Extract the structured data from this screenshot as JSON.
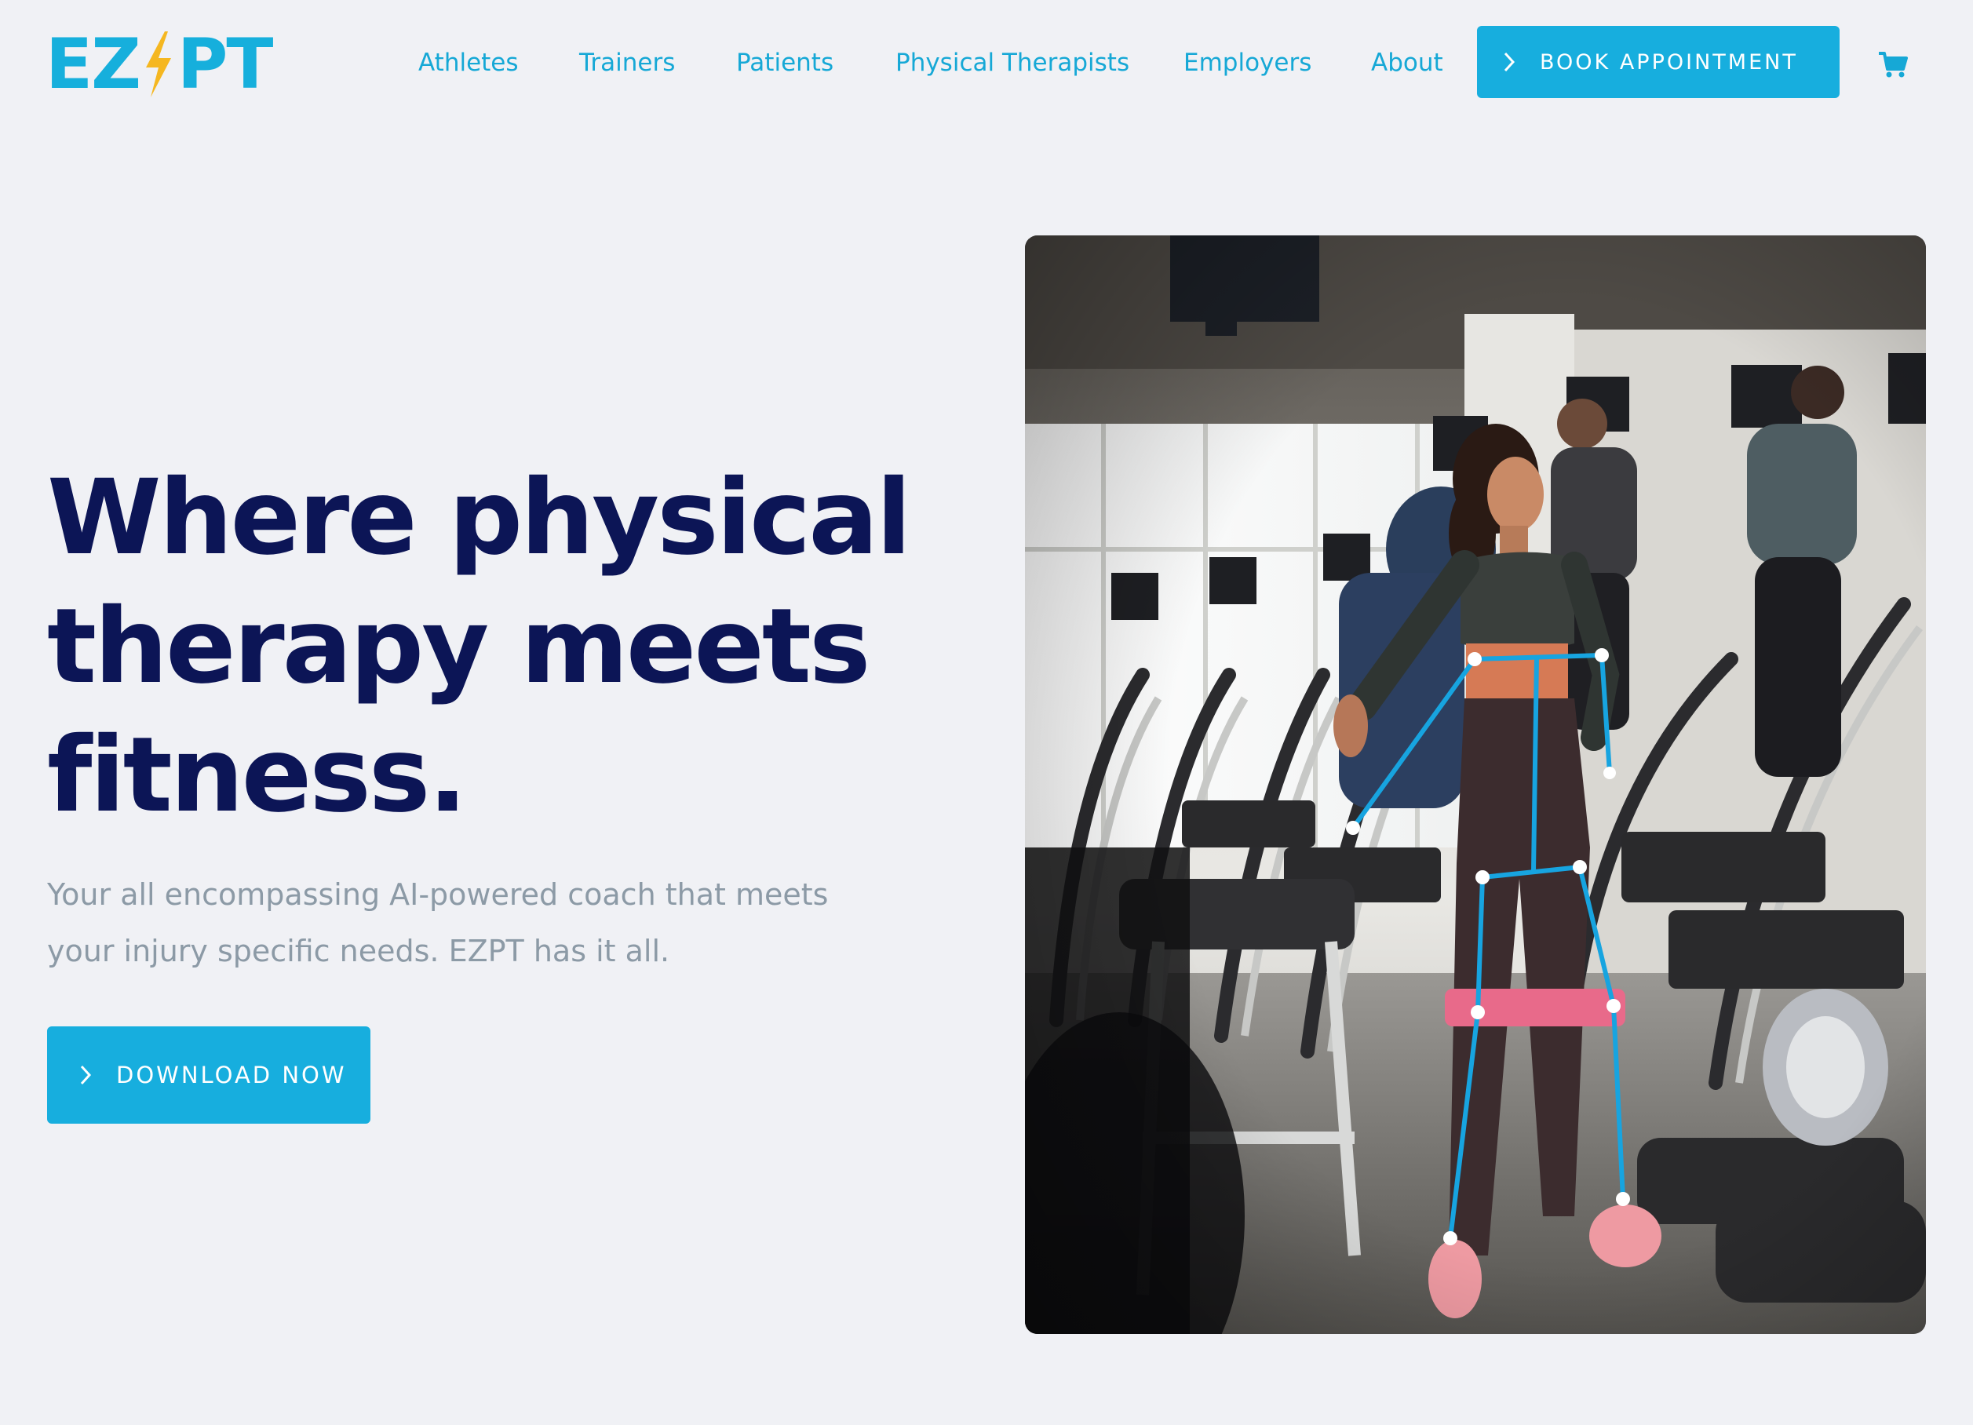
{
  "brand": {
    "logo_left": "EZ",
    "logo_right": "PT",
    "logo_color": "#16afdc",
    "bolt_color": "#f5b720",
    "accent": "#17aede",
    "heading_color": "#0c1556",
    "text_muted": "#8c9aa6",
    "background": "#f0f1f5"
  },
  "nav": {
    "items": [
      {
        "label": "Athletes"
      },
      {
        "label": "Trainers"
      },
      {
        "label": "Patients"
      },
      {
        "label": "Physical Therapists"
      },
      {
        "label": "Employers"
      },
      {
        "label": "About"
      }
    ],
    "cta_label": "BOOK APPOINTMENT",
    "cart_icon": "cart-icon"
  },
  "hero": {
    "title": "Where physical therapy meets fitness.",
    "subtitle": "Your all encompassing AI-powered coach that meets your injury specific needs. EZPT has it all.",
    "cta_label": "DOWNLOAD NOW",
    "image_icon": "gym-pose-tracking-photo"
  }
}
